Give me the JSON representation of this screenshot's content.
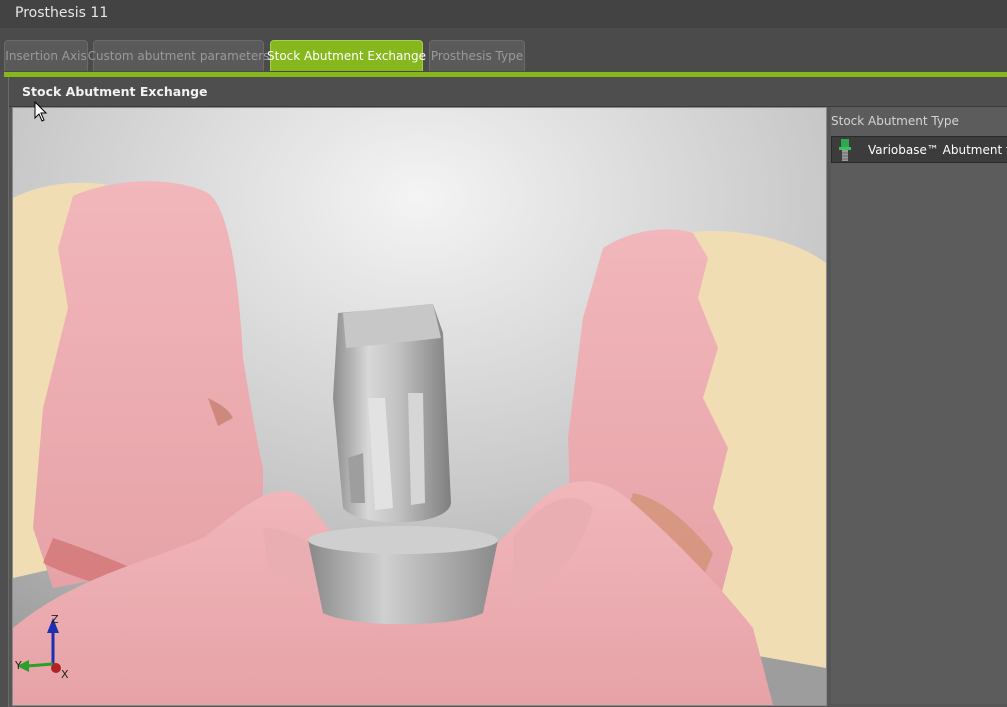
{
  "window": {
    "title": "Prosthesis 11"
  },
  "tabs": [
    {
      "label": "Insertion Axis",
      "active": false
    },
    {
      "label": "Custom abutment parameters",
      "active": false
    },
    {
      "label": "Stock Abutment Exchange",
      "active": true
    },
    {
      "label": "Prosthesis Type",
      "active": false
    }
  ],
  "panel": {
    "title": "Stock Abutment Exchange"
  },
  "sidebar": {
    "label": "Stock Abutment Type",
    "selected_item": {
      "label": "Variobase™ Abutment for",
      "icon": "abutment-icon"
    }
  },
  "viewport": {
    "axes": {
      "z": "Z",
      "y": "Y",
      "x": "X"
    }
  },
  "colors": {
    "accent": "#86b81e",
    "gingiva": "#e8a6ab",
    "tooth": "#f1ddb4",
    "abutment": "#b5b5b5"
  }
}
